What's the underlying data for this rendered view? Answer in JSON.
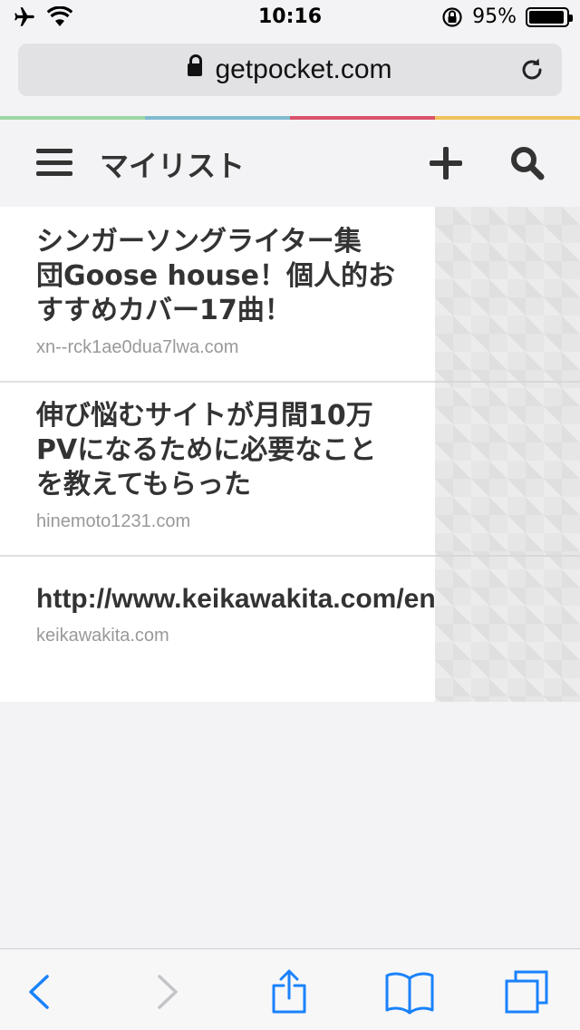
{
  "status_bar": {
    "time": "10:16",
    "battery": "95%",
    "battery_level": 0.95
  },
  "browser": {
    "url": "getpocket.com"
  },
  "header": {
    "title": "マイリスト"
  },
  "colors": {
    "stripe": [
      "#9ed6a6",
      "#7fbad0",
      "#d9536a",
      "#f0c25a"
    ],
    "accent": "#1a82fb",
    "disabled": "#c4c4c8"
  },
  "list": {
    "items": [
      {
        "title": "シンガーソングライター集\n団Goose house！個人的お\nすすめカバー17曲！",
        "domain": "xn--rck1ae0dua7lwa.com"
      },
      {
        "title": "伸び悩むサイトが月間10万\nPVになるために必要なこと\nを教えてもらった",
        "domain": "hinemoto1231.com"
      },
      {
        "title": "http://www.keikawakita.com/en\nunlimited",
        "domain": "keikawakita.com"
      }
    ]
  }
}
